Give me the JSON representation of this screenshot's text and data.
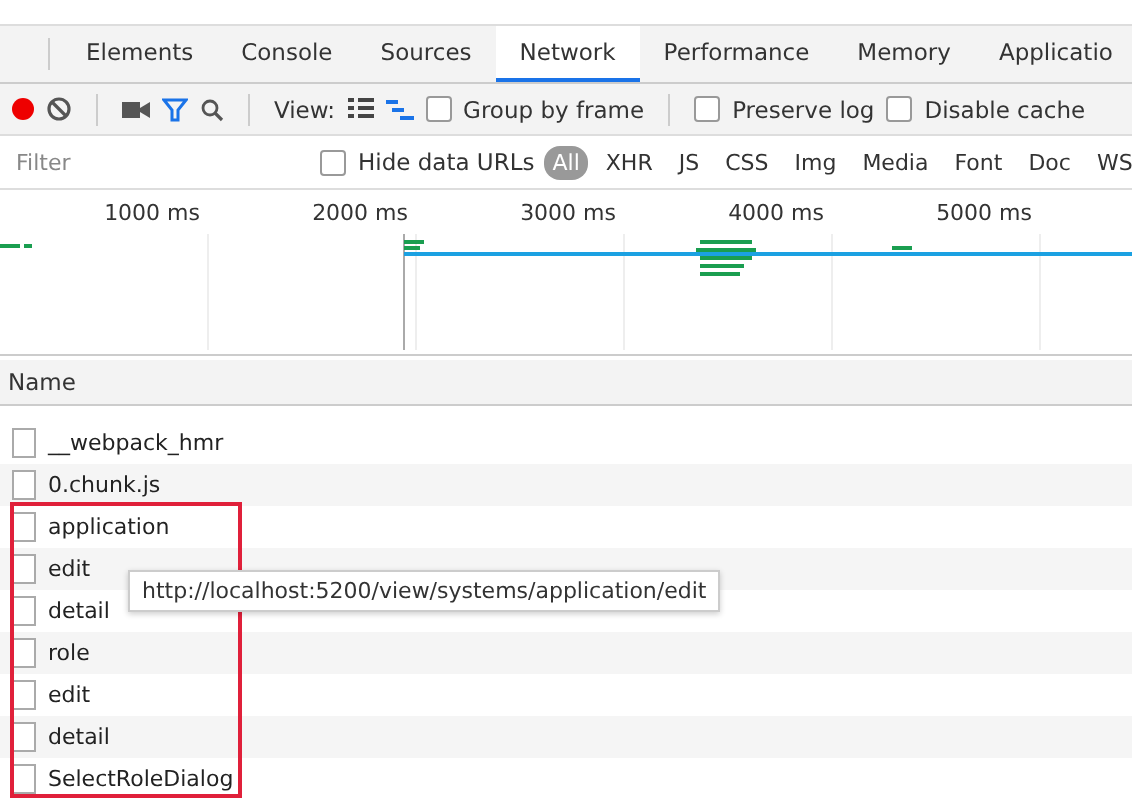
{
  "tabs": [
    {
      "label": "Elements",
      "selected": false
    },
    {
      "label": "Console",
      "selected": false
    },
    {
      "label": "Sources",
      "selected": false
    },
    {
      "label": "Network",
      "selected": true
    },
    {
      "label": "Performance",
      "selected": false
    },
    {
      "label": "Memory",
      "selected": false
    },
    {
      "label": "Applicatio",
      "selected": false
    }
  ],
  "toolbar": {
    "recording": true,
    "view_label": "View:",
    "options": [
      {
        "label": "Group by frame",
        "checked": false
      },
      {
        "label": "Preserve log",
        "checked": false
      },
      {
        "label": "Disable cache",
        "checked": false
      }
    ]
  },
  "filter_bar": {
    "placeholder": "Filter",
    "hide_data_urls": {
      "label": "Hide data URLs",
      "checked": false
    },
    "types": [
      {
        "label": "All",
        "selected": true
      },
      {
        "label": "XHR",
        "selected": false
      },
      {
        "label": "JS",
        "selected": false
      },
      {
        "label": "CSS",
        "selected": false
      },
      {
        "label": "Img",
        "selected": false
      },
      {
        "label": "Media",
        "selected": false
      },
      {
        "label": "Font",
        "selected": false
      },
      {
        "label": "Doc",
        "selected": false
      },
      {
        "label": "WS",
        "selected": false
      }
    ]
  },
  "timeline": {
    "ticks": [
      "1000 ms",
      "2000 ms",
      "3000 ms",
      "4000 ms",
      "5000 ms"
    ]
  },
  "requests": {
    "column": "Name",
    "rows": [
      {
        "name": "__webpack_hmr"
      },
      {
        "name": "0.chunk.js"
      },
      {
        "name": "application"
      },
      {
        "name": "edit"
      },
      {
        "name": "detail"
      },
      {
        "name": "role"
      },
      {
        "name": "edit"
      },
      {
        "name": "detail"
      },
      {
        "name": "SelectRoleDialog"
      }
    ]
  },
  "tooltip": "http://localhost:5200/view/systems/application/edit"
}
